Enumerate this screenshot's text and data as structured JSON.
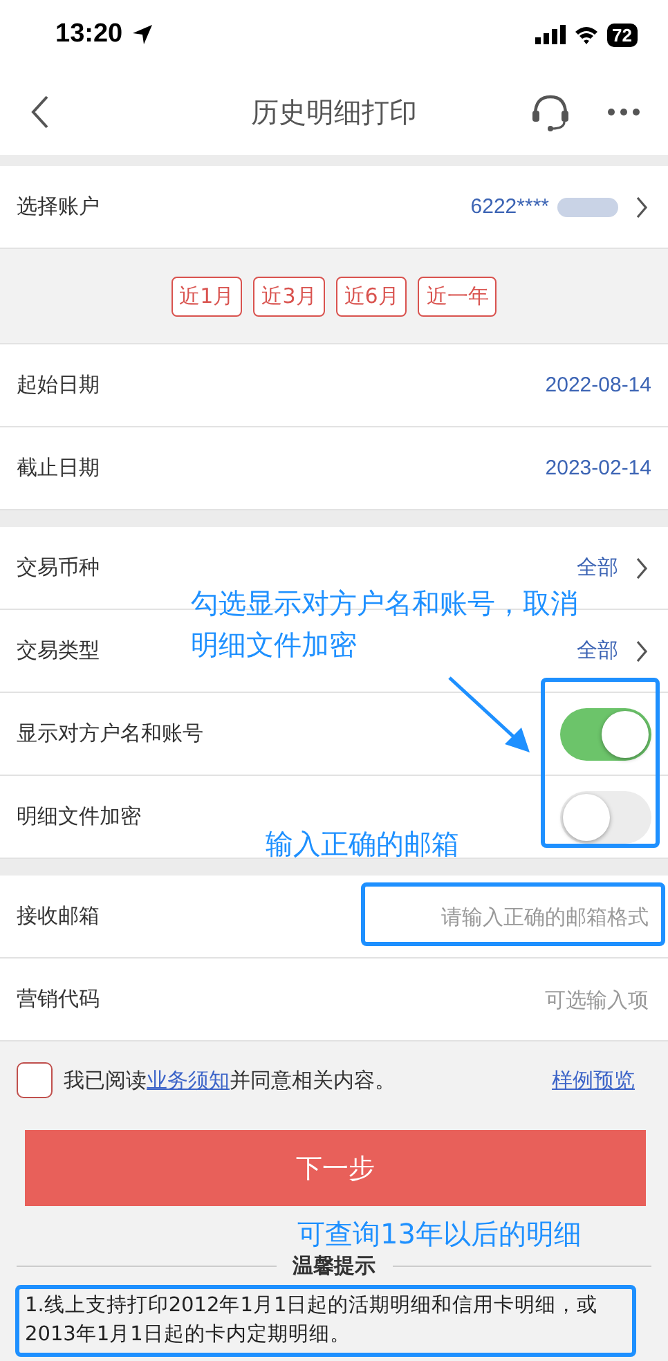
{
  "status_bar": {
    "time": "13:20",
    "battery": "72"
  },
  "nav": {
    "title": "历史明细打印"
  },
  "account": {
    "label": "选择账户",
    "value": "6222****",
    "redacted": true
  },
  "periods": [
    {
      "label": "近1月",
      "selected": false
    },
    {
      "label": "近3月",
      "selected": false
    },
    {
      "label": "近6月",
      "selected": false
    },
    {
      "label": "近一年",
      "selected": false
    }
  ],
  "dates": [
    {
      "label": "起始日期",
      "value": "2022-08-14"
    },
    {
      "label": "截止日期",
      "value": "2023-02-14"
    }
  ],
  "options": [
    {
      "kind": "select",
      "label": "交易币种",
      "value": "全部"
    },
    {
      "kind": "select",
      "label": "交易类型",
      "value": "全部"
    },
    {
      "kind": "toggle",
      "label": "显示对方户名和账号",
      "on": true
    },
    {
      "kind": "toggle",
      "label": "明细文件加密",
      "on": false
    }
  ],
  "fields": [
    {
      "label": "接收邮箱",
      "placeholder": "请输入正确的邮箱格式"
    },
    {
      "label": "营销代码",
      "placeholder": "可选输入项"
    }
  ],
  "agreement": {
    "checked": false,
    "text": "我已阅读",
    "link": "业务须知",
    "text_after": "并同意相关内容。",
    "preview_link": "样例预览"
  },
  "next_button": "下一步",
  "tips": {
    "title": "温馨提示",
    "items": [
      "1.线上支持打印2012年1月1日起的活期明细和信用卡明细，或2013年1月1日起的卡内定期明细。"
    ]
  },
  "annotations": [
    {
      "kind": "note",
      "text": "勾选显示对方户名和账号，取消"
    },
    {
      "kind": "note",
      "text": "明细文件加密"
    },
    {
      "kind": "note",
      "text": "输入正确的邮箱"
    },
    {
      "kind": "note",
      "text": "可查询13年以后的明细"
    }
  ]
}
